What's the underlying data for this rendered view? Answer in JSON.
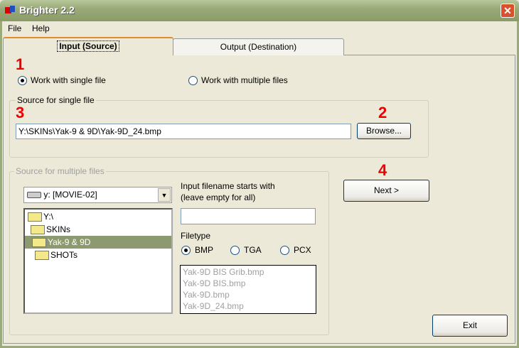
{
  "window": {
    "title": "Brighter 2.2",
    "close": "✕"
  },
  "menu": [
    "File",
    "Help"
  ],
  "tabs": [
    {
      "label": "Input (Source)",
      "active": true
    },
    {
      "label": "Output (Destination)",
      "active": false
    }
  ],
  "steps": {
    "s1": "1",
    "s2": "2",
    "s3": "3",
    "s4": "4"
  },
  "mode": {
    "single": "Work with single file",
    "multiple": "Work with multiple files",
    "selected": "single"
  },
  "single": {
    "group_label": "Source for single file",
    "path": "Y:\\SKINs\\Yak-9 & 9D\\Yak-9D_24.bmp",
    "browse": "Browse..."
  },
  "multiple": {
    "group_label": "Source for multiple files",
    "drive": "y: [MOVIE-02]",
    "tree": [
      "Y:\\",
      "SKINs",
      "Yak-9 & 9D",
      "SHOTs"
    ],
    "tree_selected": "Yak-9 & 9D",
    "prefix_label_1": "Input filename starts with",
    "prefix_label_2": "(leave empty for all)",
    "prefix_value": "",
    "filetype_label": "Filetype",
    "filetypes": [
      "BMP",
      "TGA",
      "PCX"
    ],
    "filetype_selected": "BMP",
    "files": [
      "Yak-9D BIS Grib.bmp",
      "Yak-9D BIS.bmp",
      "Yak-9D.bmp",
      "Yak-9D_24.bmp"
    ]
  },
  "buttons": {
    "next": "Next >",
    "exit": "Exit"
  }
}
